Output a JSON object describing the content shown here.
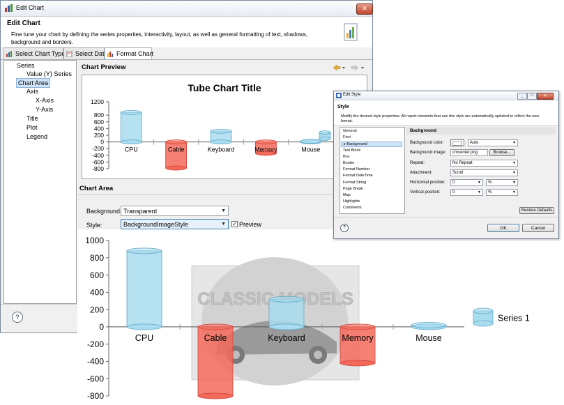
{
  "edit_chart": {
    "window_title": "Edit Chart",
    "header_title": "Edit Chart",
    "header_desc": "Fine tune your chart by defining the series properties, interactivity, layout, as well as general formatting of text, shadows, background and borders.",
    "tabs": [
      "Select Chart Type",
      "Select Data",
      "Format Chart"
    ],
    "tree": [
      "Series",
      "Value (Y) Series",
      "Chart Area",
      "Axis",
      "X-Axis",
      "Y-Axis",
      "Title",
      "Plot",
      "Legend"
    ],
    "selected_tree_item": "Chart Area",
    "chart_preview_label": "Chart Preview",
    "chart_area_label": "Chart Area",
    "background_label": "Background:",
    "background_value": "Transparent",
    "style_label": "Style:",
    "style_value": "BackgroundImageStyle",
    "preview_checkbox_label": "Preview",
    "preview_checked": true,
    "help_icon": "?"
  },
  "edit_style": {
    "window_title": "Edit Style",
    "heading": "Style",
    "desc": "Modify the desired style properties. All report elements that use this style are automatically updated to reflect the new format.",
    "categories": [
      "General",
      "Font",
      "Background",
      "Text Block",
      "Box",
      "Border",
      "Format Number",
      "Format DateTime",
      "Format String",
      "Page Break",
      "Map",
      "Highlights",
      "Comments"
    ],
    "selected_category": "Background",
    "section_title": "Background",
    "bg_color_label": "Background color:",
    "bg_color_value": "Auto",
    "bg_image_label": "Background image:",
    "bg_image_value": "cmcenter.png",
    "browse_label": "Browse...",
    "repeat_label": "Repeat:",
    "repeat_value": "No Repeat",
    "attachment_label": "Attachment:",
    "attachment_value": "Scroll",
    "hpos_label": "Horizontal position:",
    "hpos_value": "0",
    "hpos_unit": "%",
    "vpos_label": "Vertical position:",
    "vpos_value": "0",
    "vpos_unit": "%",
    "restore_label": "Restore Defaults",
    "ok_label": "OK",
    "cancel_label": "Cancel",
    "help_icon": "?"
  },
  "colors": {
    "positive": "#a9dcef",
    "negative": "#f46a5a",
    "selection": "#cfe3f7"
  },
  "watermark_text": "CLASSIC MODELS",
  "chart_data": [
    {
      "type": "bar",
      "title": "Tube Chart Title",
      "categories": [
        "CPU",
        "Cable",
        "Keyboard",
        "Memory",
        "Mouse"
      ],
      "values": [
        880,
        -780,
        320,
        -340,
        20
      ],
      "ylim": [
        -800,
        1200
      ],
      "yticks": [
        -800,
        -600,
        -400,
        -200,
        0,
        200,
        400,
        600,
        800,
        1200
      ],
      "legend": "right",
      "style": "tube"
    },
    {
      "type": "bar",
      "title": "",
      "categories": [
        "CPU",
        "Cable",
        "Keyboard",
        "Memory",
        "Mouse"
      ],
      "series": [
        {
          "name": "Series 1",
          "values": [
            880,
            -800,
            320,
            -420,
            20
          ]
        }
      ],
      "ylim": [
        -800,
        1000
      ],
      "yticks": [
        -800,
        -600,
        -400,
        -200,
        0,
        200,
        400,
        600,
        800,
        1000
      ],
      "legend": "right",
      "style": "tube"
    }
  ]
}
